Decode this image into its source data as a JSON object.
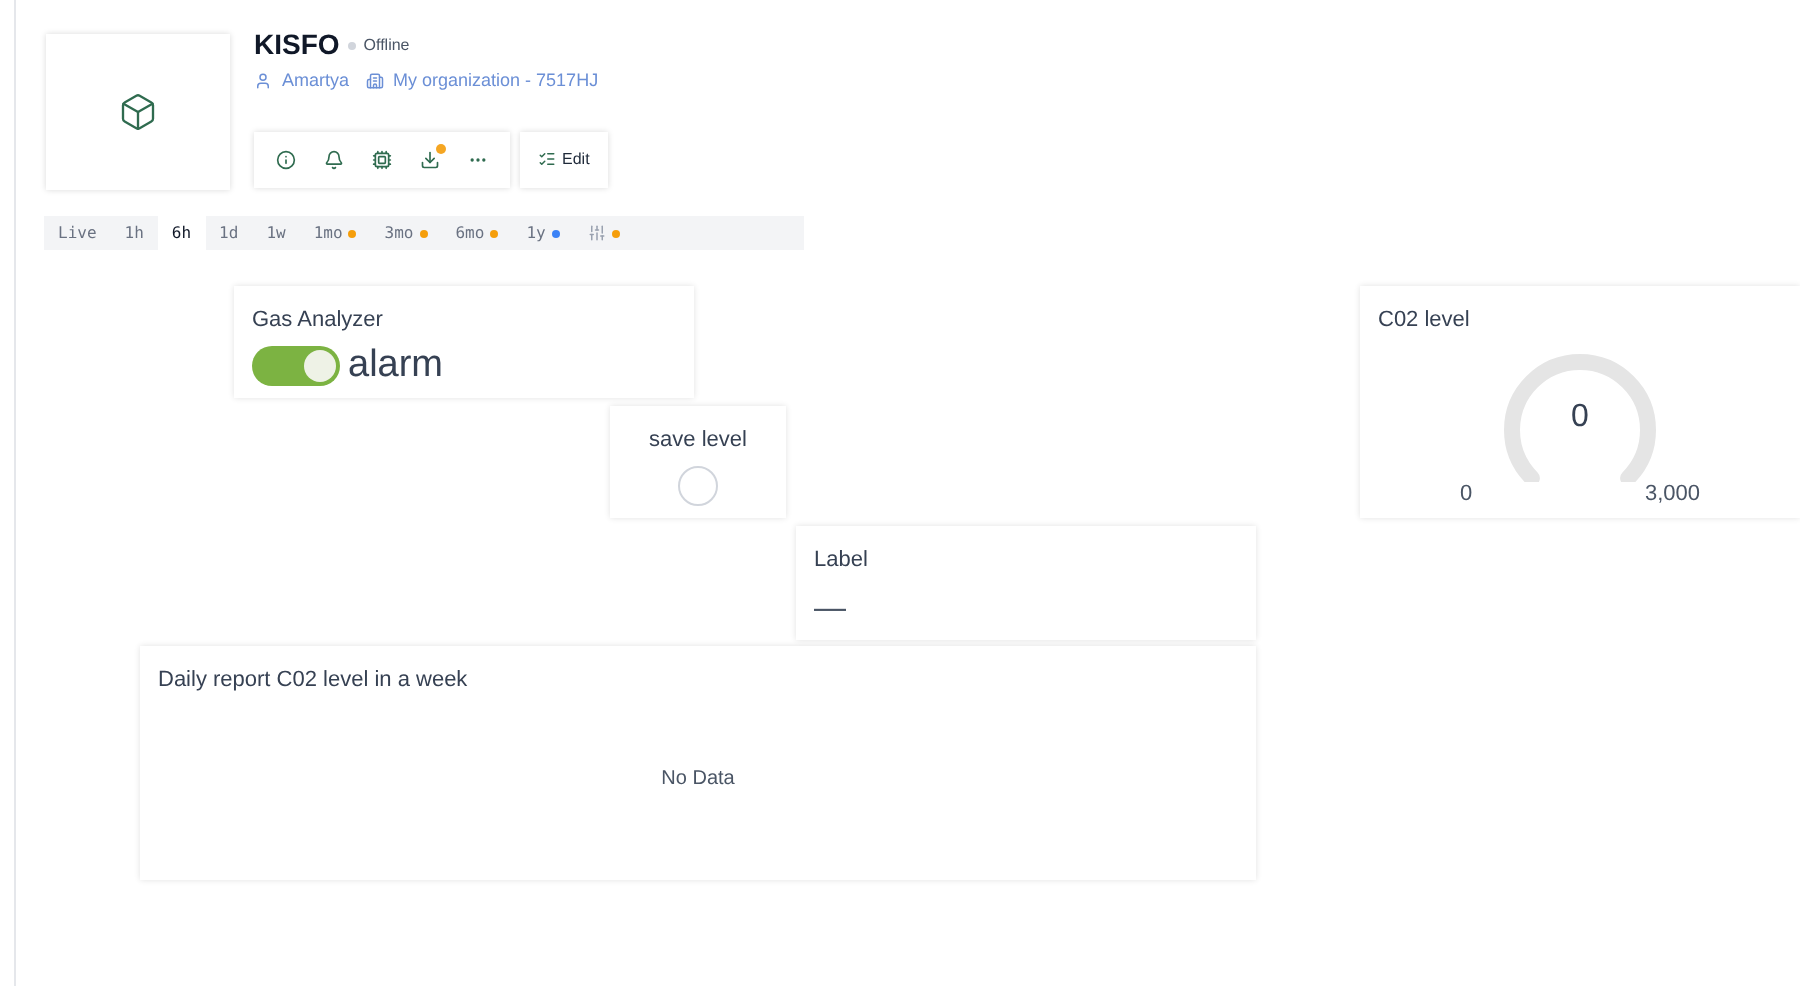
{
  "device": {
    "name": "KISFO",
    "status": "Offline",
    "online": false,
    "owner": "Amartya",
    "organization": "My organization - 7517HJ"
  },
  "tools": [
    {
      "kind": "info",
      "badge": false
    },
    {
      "kind": "bell",
      "badge": false
    },
    {
      "kind": "chip",
      "badge": false
    },
    {
      "kind": "download",
      "badge": true
    },
    {
      "kind": "more",
      "badge": false
    }
  ],
  "edit_button": "Edit",
  "time_ranges": [
    {
      "label": "Live",
      "selected": false
    },
    {
      "label": "1h",
      "selected": false
    },
    {
      "label": "6h",
      "selected": true
    },
    {
      "label": "1d",
      "selected": false
    },
    {
      "label": "1w",
      "selected": false
    },
    {
      "label": "1mo",
      "selected": false,
      "color": "#f59e0b"
    },
    {
      "label": "3mo",
      "selected": false,
      "color": "#f59e0b"
    },
    {
      "label": "6mo",
      "selected": false,
      "color": "#f59e0b"
    },
    {
      "label": "1y",
      "selected": false,
      "color": "#3b82f6"
    },
    {
      "kind": "filter",
      "selected": false,
      "color": "#f59e0b"
    }
  ],
  "widgets": [
    {
      "kind": "switch",
      "title": "Gas Analyzer",
      "label": "alarm",
      "on": true
    },
    {
      "kind": "led",
      "title": "save level",
      "on": false
    },
    {
      "kind": "gauge",
      "title": "C02 level",
      "value": "0",
      "min": "0",
      "max": "3,000"
    },
    {
      "kind": "value",
      "title": "Label",
      "value": "—"
    },
    {
      "kind": "chart",
      "title": "Daily report C02 level in a week",
      "message": "No Data"
    }
  ]
}
